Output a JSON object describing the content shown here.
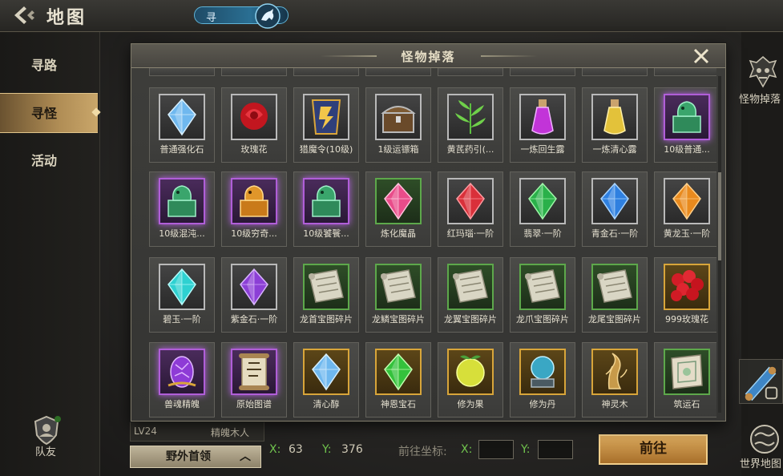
{
  "header": {
    "title": "地图",
    "search_tab": "寻"
  },
  "sidebar": {
    "items": [
      {
        "label": "寻路",
        "active": false
      },
      {
        "label": "寻怪",
        "active": true
      },
      {
        "label": "活动",
        "active": false
      }
    ]
  },
  "teammate": {
    "label": "队友"
  },
  "target": {
    "level": "LV24",
    "monster": "精魄木人"
  },
  "boss_button": {
    "label": "野外首领"
  },
  "coords": {
    "x_label": "X:",
    "x_value": "63",
    "y_label": "Y:",
    "y_value": "376",
    "goto_label": "前往坐标:",
    "goto_x_label": "X:",
    "goto_y_label": "Y:",
    "goto_x_value": "",
    "goto_y_value": ""
  },
  "go_button": {
    "label": "前往"
  },
  "right_panel": {
    "monster_drop_label": "怪物掉落",
    "world_map_label": "世界地图"
  },
  "modal": {
    "title": "怪物掉落",
    "items": [
      {
        "name": "普通强化石",
        "icon": "blue-crystal-icon",
        "rarity": "white"
      },
      {
        "name": "玫瑰花",
        "icon": "red-rose-icon",
        "rarity": "white"
      },
      {
        "name": "猎魔令(10级)",
        "icon": "token-icon",
        "rarity": "white"
      },
      {
        "name": "1级运镖箱",
        "icon": "treasure-chest-icon",
        "rarity": "white"
      },
      {
        "name": "黄芪药引(...",
        "icon": "herb-icon",
        "rarity": "white"
      },
      {
        "name": "一炼回生露",
        "icon": "purple-potion-icon",
        "rarity": "white"
      },
      {
        "name": "一炼清心露",
        "icon": "yellow-potion-icon",
        "rarity": "white"
      },
      {
        "name": "10级普通...",
        "icon": "jade-seal-icon",
        "rarity": "purple"
      },
      {
        "name": "10级混沌...",
        "icon": "jade-seal-icon",
        "rarity": "purple"
      },
      {
        "name": "10级穷奇...",
        "icon": "gold-seal-icon",
        "rarity": "purple"
      },
      {
        "name": "10级饕餮...",
        "icon": "jade-seal-icon",
        "rarity": "purple"
      },
      {
        "name": "炼化魔晶",
        "icon": "pink-gem-icon",
        "rarity": "green"
      },
      {
        "name": "红玛瑙·一阶",
        "icon": "red-gem-icon",
        "rarity": "white"
      },
      {
        "name": "翡翠·一阶",
        "icon": "green-gem-icon",
        "rarity": "white"
      },
      {
        "name": "青金石·一阶",
        "icon": "blue-gem-icon",
        "rarity": "white"
      },
      {
        "name": "黄龙玉·一阶",
        "icon": "orange-gem-icon",
        "rarity": "white"
      },
      {
        "name": "碧玉·一阶",
        "icon": "cyan-gem-icon",
        "rarity": "white"
      },
      {
        "name": "紫金石·一阶",
        "icon": "violet-gem-icon",
        "rarity": "white"
      },
      {
        "name": "龙首宝图碎片",
        "icon": "map-scroll-icon",
        "rarity": "green"
      },
      {
        "name": "龙鳞宝图碎片",
        "icon": "map-scroll-icon",
        "rarity": "green"
      },
      {
        "name": "龙翼宝图碎片",
        "icon": "map-scroll-icon",
        "rarity": "green"
      },
      {
        "name": "龙爪宝图碎片",
        "icon": "map-scroll-icon",
        "rarity": "green"
      },
      {
        "name": "龙尾宝图碎片",
        "icon": "map-scroll-icon",
        "rarity": "green"
      },
      {
        "name": "999玫瑰花",
        "icon": "rose-bouquet-icon",
        "rarity": "gold"
      },
      {
        "name": "兽魂精魄",
        "icon": "purple-egg-icon",
        "rarity": "purple"
      },
      {
        "name": "原始图谱",
        "icon": "ancient-scroll-icon",
        "rarity": "purple"
      },
      {
        "name": "清心醇",
        "icon": "blue-crystal-icon",
        "rarity": "gold"
      },
      {
        "name": "神恩宝石",
        "icon": "green-crystal-icon",
        "rarity": "gold"
      },
      {
        "name": "修为果",
        "icon": "fruit-icon",
        "rarity": "gold"
      },
      {
        "name": "修为丹",
        "icon": "orb-icon",
        "rarity": "gold"
      },
      {
        "name": "神灵木",
        "icon": "wood-icon",
        "rarity": "gold"
      },
      {
        "name": "筑运石",
        "icon": "tablet-icon",
        "rarity": "green"
      }
    ]
  }
}
